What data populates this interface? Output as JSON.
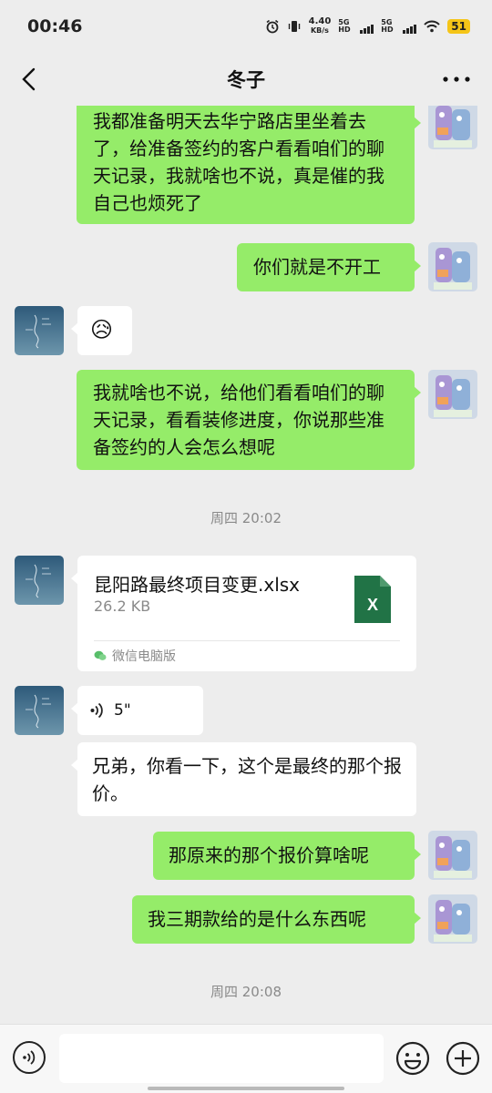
{
  "status_bar": {
    "time": "00:46",
    "net_speed_value": "4.40",
    "net_speed_unit": "KB/s",
    "sim1": "5G HD",
    "sim2": "5G HD",
    "battery": "51"
  },
  "header": {
    "title": "冬子",
    "back_icon": "chevron-left-icon",
    "more_icon": "more-dots-icon"
  },
  "messages": [
    {
      "side": "right",
      "text": "我都准备明天去华宁路店里坐着去了，给准备签约的客户看看咱们的聊天记录，我就啥也不说，真是催的我自己也烦死了"
    },
    {
      "side": "right",
      "text": "你们就是不开工"
    },
    {
      "side": "left",
      "emoji": "😥"
    },
    {
      "side": "right",
      "text": "我就啥也不说，给他们看看咱们的聊天记录，看看装修进度，你说那些准备签约的人会怎么想呢"
    }
  ],
  "timestamp_1": "周四 20:02",
  "file_message": {
    "name": "昆阳路最终项目变更.xlsx",
    "size": "26.2 KB",
    "source": "微信电脑版",
    "icon_letter": "X",
    "icon_color": "#217346"
  },
  "voice_message": {
    "duration": "5\""
  },
  "text_message_left": "兄弟，你看一下，这个是最终的那个报价。",
  "messages_2": [
    {
      "side": "right",
      "text": "那原来的那个报价算啥呢"
    },
    {
      "side": "right",
      "text": "我三期款给的是什么东西呢"
    }
  ],
  "timestamp_2": "周四 20:08",
  "input_bar": {
    "placeholder": "",
    "voice_icon": "voice-input-icon",
    "emoji_icon": "emoji-icon",
    "plus_icon": "plus-icon"
  },
  "colors": {
    "green_bubble": "#95ec69",
    "background": "#ededed"
  }
}
